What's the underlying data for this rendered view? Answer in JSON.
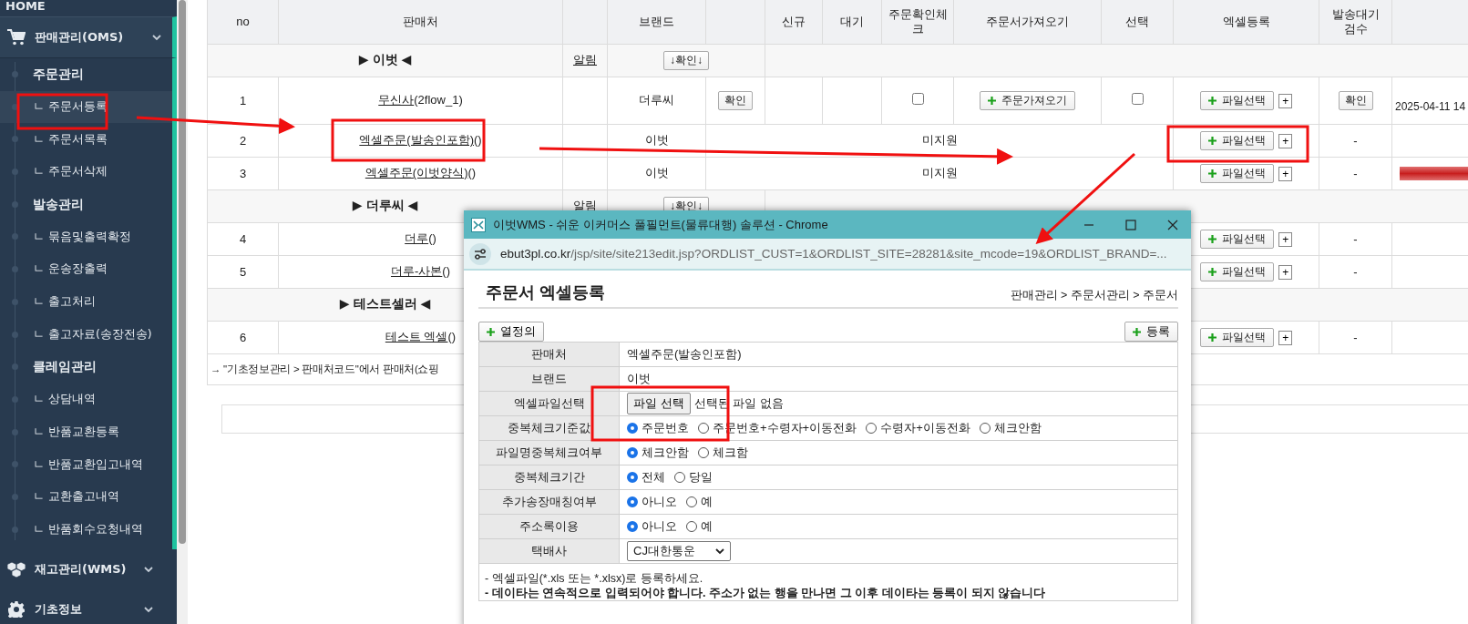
{
  "sidebar": {
    "top_item": "HOME",
    "menus": [
      {
        "label": "판매관리(OMS)",
        "expanded": true,
        "children": [
          {
            "label": "주문관리",
            "kind": "heading",
            "selected": false
          },
          {
            "label": "ㄴ 주문서등록",
            "kind": "link",
            "selected": true
          },
          {
            "label": "ㄴ 주문서목록",
            "kind": "link",
            "selected": false
          },
          {
            "label": "ㄴ 주문서삭제",
            "kind": "link",
            "selected": false
          },
          {
            "label": "발송관리",
            "kind": "heading",
            "selected": false
          },
          {
            "label": "ㄴ 묶음및출력확정",
            "kind": "link",
            "selected": false
          },
          {
            "label": "ㄴ 운송장출력",
            "kind": "link",
            "selected": false
          },
          {
            "label": "ㄴ 출고처리",
            "kind": "link",
            "selected": false
          },
          {
            "label": "ㄴ 출고자료(송장전송)",
            "kind": "link",
            "selected": false
          },
          {
            "label": "클레임관리",
            "kind": "heading",
            "selected": false
          },
          {
            "label": "ㄴ 상담내역",
            "kind": "link",
            "selected": false
          },
          {
            "label": "ㄴ 반품교환등록",
            "kind": "link",
            "selected": false
          },
          {
            "label": "ㄴ 반품교환입고내역",
            "kind": "link",
            "selected": false
          },
          {
            "label": "ㄴ 교환출고내역",
            "kind": "link",
            "selected": false
          },
          {
            "label": "ㄴ 반품회수요청내역",
            "kind": "link",
            "selected": false
          }
        ]
      },
      {
        "label": "재고관리(WMS)",
        "expanded": false
      },
      {
        "label": "기초정보",
        "expanded": false
      }
    ]
  },
  "table": {
    "columns": [
      {
        "lines": [
          "no"
        ]
      },
      {
        "lines": [
          "판매처"
        ]
      },
      {
        "lines": [
          "브랜드"
        ]
      },
      {
        "lines": [
          "신규"
        ]
      },
      {
        "lines": [
          "대기"
        ]
      },
      {
        "lines": [
          "주문확인체",
          "크"
        ]
      },
      {
        "lines": [
          "주문서가져오기"
        ]
      },
      {
        "lines": [
          "선택"
        ]
      },
      {
        "lines": [
          "엑셀등록"
        ]
      },
      {
        "lines": [
          "발송대기",
          "검수"
        ]
      }
    ],
    "rows": [
      {
        "kind": "group",
        "name": "▶ 이벗 ◀",
        "alert": "알림",
        "button": "↓확인↓"
      },
      {
        "kind": "order",
        "no": "1",
        "seller": "무신사",
        "seller_suffix": "(2flow_1)",
        "brand": "더루씨",
        "brand_button": "확인",
        "order_check": false,
        "fetch_button": "주문가져오기",
        "select": false,
        "excel_button": "파일선택",
        "excel_plus": "+",
        "inspect_button": "확인",
        "date": "2025-04-11 14"
      },
      {
        "kind": "unsupported",
        "no": "2",
        "seller": "엑셀주문(발송인포함)",
        "seller_suffix": "()",
        "brand": "이벗",
        "support": "미지원",
        "excel_button": "파일선택",
        "excel_plus": "+",
        "inspect": "-",
        "flag": false
      },
      {
        "kind": "unsupported",
        "no": "3",
        "seller": "엑셀주문(이벗양식)",
        "seller_suffix": "()",
        "brand": "이벗",
        "support": "미지원",
        "excel_button": "파일선택",
        "excel_plus": "+",
        "inspect": "-",
        "flag": true
      },
      {
        "kind": "group",
        "name": "▶ 더루씨 ◀",
        "alert": "알림",
        "button": "↓확인↓"
      },
      {
        "kind": "partial",
        "no": "4",
        "seller": "더루",
        "seller_suffix": "()",
        "excel_button": "파일선택",
        "excel_plus": "+",
        "inspect": "-"
      },
      {
        "kind": "partial",
        "no": "5",
        "seller": "더루-사본",
        "seller_suffix": "()",
        "excel_button": "파일선택",
        "excel_plus": "+",
        "inspect": "-"
      },
      {
        "kind": "group",
        "name": "▶ 테스트셀러 ◀"
      },
      {
        "kind": "partial",
        "no": "6",
        "seller": "테스트 엑셀",
        "seller_suffix": "()",
        "excel_button": "파일선택",
        "excel_plus": "+",
        "inspect": "-"
      },
      {
        "kind": "note",
        "text": "→ \"기초정보관리 > 판매처코드\"에서 판매처(쇼핑"
      }
    ]
  },
  "popup": {
    "title": "이벗WMS - 쉬운 이커머스 풀필먼트(물류대행) 솔루션 - Chrome",
    "url_host": "ebut3pl.co.kr",
    "url_path": "/jsp/site/site213edit.jsp?ORDLIST_CUST=1&ORDLIST_SITE=28281&site_mcode=19&ORDLIST_BRAND=...",
    "heading": "주문서 엑셀등록",
    "breadcrumb": "판매관리 > 주문서관리 > 주문서",
    "left_button": "열정의",
    "right_button": "등록",
    "fields": [
      {
        "kind": "text",
        "label": "판매처",
        "value": "엑셀주문(발송인포함)"
      },
      {
        "kind": "text",
        "label": "브랜드",
        "value": "이벗"
      },
      {
        "kind": "file",
        "label": "엑셀파일선택",
        "button": "파일 선택",
        "value": "선택된 파일 없음"
      },
      {
        "kind": "radio",
        "label": "중복체크기준값",
        "options": [
          {
            "label": "주문번호",
            "selected": true
          },
          {
            "label": "주문번호+수령자+이동전화",
            "selected": false
          },
          {
            "label": "수령자+이동전화",
            "selected": false
          },
          {
            "label": "체크안함",
            "selected": false
          }
        ]
      },
      {
        "kind": "radio",
        "label": "파일명중복체크여부",
        "options": [
          {
            "label": "체크안함",
            "selected": true
          },
          {
            "label": "체크함",
            "selected": false
          }
        ]
      },
      {
        "kind": "radio",
        "label": "중복체크기간",
        "options": [
          {
            "label": "전체",
            "selected": true
          },
          {
            "label": "당일",
            "selected": false
          }
        ]
      },
      {
        "kind": "radio",
        "label": "추가송장매칭여부",
        "options": [
          {
            "label": "아니오",
            "selected": true
          },
          {
            "label": "예",
            "selected": false
          }
        ]
      },
      {
        "kind": "radio",
        "label": "주소록이용",
        "options": [
          {
            "label": "아니오",
            "selected": true
          },
          {
            "label": "예",
            "selected": false
          }
        ]
      },
      {
        "kind": "select",
        "label": "택배사",
        "value": "CJ대한통운"
      }
    ],
    "notes": [
      {
        "text": "- 엑셀파일(*.xls 또는 *.xlsx)로 등록하세요.",
        "bold": false
      },
      {
        "text": "- 데이타는 연속적으로 입력되어야 합니다. 주소가 없는 행을 만나면 그 이후 데이타는 등록이 되지 않습니다",
        "bold": true
      }
    ]
  }
}
